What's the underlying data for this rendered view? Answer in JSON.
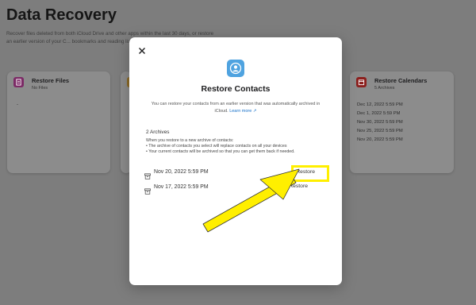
{
  "page": {
    "title": "Data Recovery",
    "description": "Recover files deleted from both iCloud Drive and other apps within the last 30 days, or restore an earlier version of your C... bookmarks and reading list."
  },
  "cards": {
    "files": {
      "title": "Restore Files",
      "subtitle": "No Files",
      "placeholder": "-",
      "icon": "document-icon",
      "color": "#7c2a66"
    },
    "contacts": {
      "icon": "contacts-icon",
      "color": "#8c6a28"
    },
    "calendars": {
      "title": "Restore Calendars",
      "subtitle": "5 Archives",
      "icon": "calendar-icon",
      "color": "#8b1f1d",
      "items": [
        "Dec 12, 2022 5:59 PM",
        "Dec 1, 2022 5:59 PM",
        "Nov 30, 2022 5:59 PM",
        "Nov 25, 2022 5:59 PM",
        "Nov 20, 2022 5:59 PM"
      ]
    }
  },
  "modal": {
    "title": "Restore Contacts",
    "description": "You can restore your contacts from an earlier version that was automatically archived in iCloud.",
    "learn_more": "Learn more ↗",
    "archives_count": "2 Archives",
    "info_intro": "When you restore to a new archive of contacts:",
    "info_bullets": [
      "The archive of contacts you select will replace contacts on all your devices",
      "Your current contacts will be archived so that you can get them back if needed."
    ],
    "archives": [
      {
        "date": "Nov 20, 2022 5:59 PM",
        "action": "Restore",
        "highlighted": true
      },
      {
        "date": "Nov 17, 2022 5:59 PM",
        "action": "Restore",
        "highlighted": false
      }
    ],
    "icon_color": "#4fa3e0"
  },
  "annotation": {
    "highlight_color": "#ffef00"
  }
}
